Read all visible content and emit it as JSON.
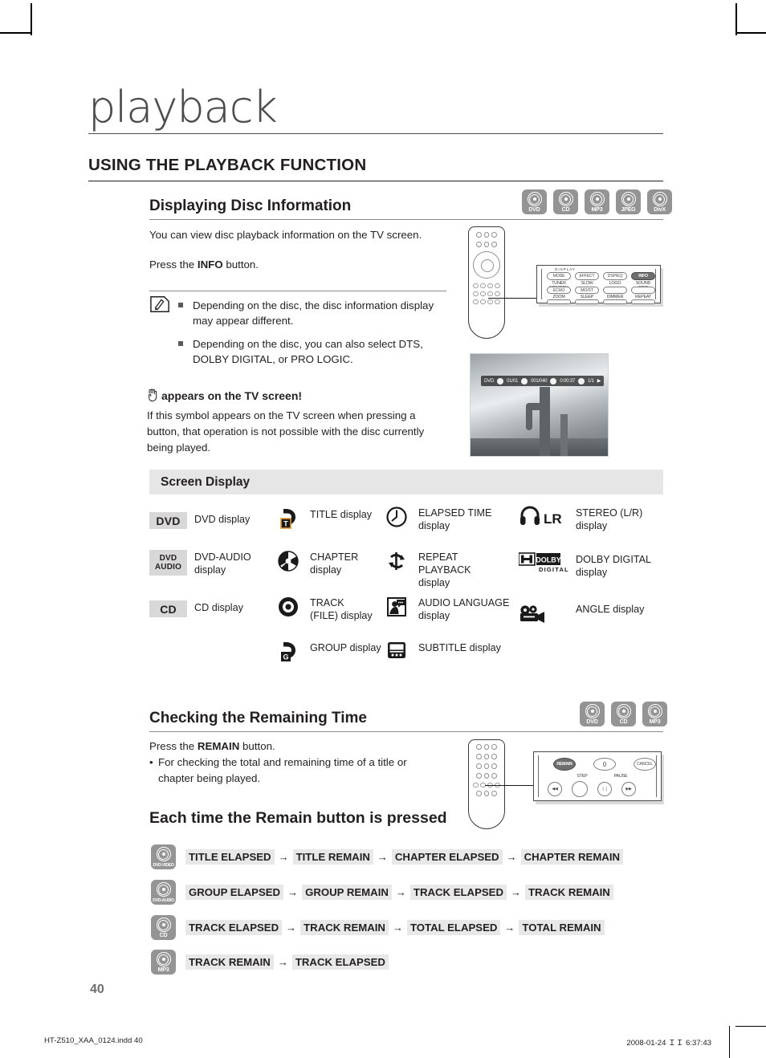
{
  "page": {
    "chapter_title": "playback",
    "section_title": "USING THE PLAYBACK FUNCTION",
    "page_number": "40"
  },
  "footer": {
    "file_name": "HT-Z510_XAA_0124.indd   40",
    "timestamp": "2008-01-24   ＩＩ 6:37:43"
  },
  "disc_info": {
    "heading": "Displaying Disc Information",
    "badges": [
      {
        "label": "DVD",
        "icon": "disc-icon"
      },
      {
        "label": "CD",
        "icon": "disc-icon"
      },
      {
        "label": "MP3",
        "icon": "disc-icon"
      },
      {
        "label": "JPEG",
        "icon": "disc-icon"
      },
      {
        "label": "DivX",
        "icon": "disc-icon"
      }
    ],
    "intro": "You can view disc playback information  on the TV screen.",
    "press_prefix": "Press the ",
    "press_bold": "INFO",
    "press_suffix": " button.",
    "notes": [
      "Depending on the disc, the disc information display may appear different.",
      "Depending on the disc, you can also select DTS, DOLBY DIGITAL, or PRO LOGIC."
    ],
    "hand_heading": "appears on the TV screen!",
    "hand_body": "If this symbol appears on the TV screen when pressing a button, that operation is not possible with the disc currently being played."
  },
  "remote_info_callout": {
    "row1": [
      "MODE",
      "EFFECT",
      "DSP/EQ",
      "INFO"
    ],
    "row1_highlight": "INFO",
    "row2_labels": [
      "TUNER MEMORY",
      "SLOW",
      "LOGO",
      "SOUND EDIT"
    ],
    "row2_buttons": [
      "ECHO",
      "MO/ST",
      "",
      ""
    ],
    "row3_labels": [
      "ZOOM",
      "SLEEP",
      "DIMMER",
      "REPEAT"
    ],
    "group_label": "DISPLAY"
  },
  "tv_osd": {
    "disc_type": "DVD",
    "title": "01/01",
    "chapter": "001/040",
    "elapsed": "0:00:37",
    "angle": "1/1"
  },
  "screen_display": {
    "header": "Screen Display",
    "column1": [
      {
        "tag": "DVD",
        "tag_lines": [
          "DVD"
        ],
        "label": "DVD display",
        "icon": "dvd-tag"
      },
      {
        "tag": "DVD AUDIO",
        "tag_lines": [
          "DVD",
          "AUDIO"
        ],
        "label": "DVD-AUDIO display",
        "icon": "dvd-audio-tag"
      },
      {
        "tag": "CD",
        "tag_lines": [
          "CD"
        ],
        "label": "CD display",
        "icon": "cd-tag"
      }
    ],
    "column2": [
      {
        "label": "TITLE display",
        "icon": "title-icon"
      },
      {
        "label": "CHAPTER display",
        "icon": "chapter-icon"
      },
      {
        "label": "TRACK (FILE) display",
        "icon": "track-icon"
      },
      {
        "label": "GROUP display",
        "icon": "group-icon"
      }
    ],
    "column3": [
      {
        "label": "ELAPSED TIME display",
        "icon": "clock-icon"
      },
      {
        "label": "REPEAT PLAYBACK display",
        "icon": "repeat-icon"
      },
      {
        "label": "AUDIO LANGUAGE display",
        "icon": "audio-language-icon"
      },
      {
        "label": "SUBTITLE display",
        "icon": "subtitle-icon"
      }
    ],
    "column4": [
      {
        "label": "STEREO (L/R) display",
        "icon": "headphone-icon",
        "icon_text": "LR"
      },
      {
        "label": "DOLBY DIGITAL display",
        "icon": "dolby-digital-icon",
        "icon_text": "DOLBY DIGITAL"
      },
      {
        "label": "ANGLE display",
        "icon": "angle-camera-icon"
      }
    ]
  },
  "remaining_time": {
    "heading": "Checking the Remaining Time",
    "badges": [
      {
        "label": "DVD",
        "icon": "disc-icon"
      },
      {
        "label": "CD",
        "icon": "disc-icon"
      },
      {
        "label": "MP3",
        "icon": "disc-icon"
      }
    ],
    "press_prefix": "Press the ",
    "press_bold": "REMAIN",
    "press_suffix": " button.",
    "bullet": "For checking the total and remaining time of a title or chapter being played.",
    "each_time_heading": "Each time the Remain button is pressed",
    "callout": {
      "buttons": [
        "REMAIN",
        "0",
        "CANCEL"
      ],
      "highlight": "REMAIN",
      "labels": [
        "STEP",
        "PAUSE"
      ],
      "transport": [
        "◀◀",
        "",
        "❘❘",
        "▶▶"
      ]
    },
    "sequences": [
      {
        "badge": "DVD-VIDEO",
        "items": [
          "TITLE ELAPSED",
          "TITLE REMAIN",
          "CHAPTER ELAPSED",
          "CHAPTER REMAIN"
        ]
      },
      {
        "badge": "DVD-AUDIO",
        "items": [
          "GROUP ELAPSED",
          "GROUP REMAIN",
          "TRACK ELAPSED",
          "TRACK REMAIN"
        ]
      },
      {
        "badge": "CD",
        "items": [
          "TRACK ELAPSED",
          "TRACK REMAIN",
          "TOTAL ELAPSED",
          "TOTAL REMAIN"
        ]
      },
      {
        "badge": "MP3",
        "items": [
          "TRACK REMAIN",
          "TRACK ELAPSED"
        ]
      }
    ],
    "arrow": "→"
  },
  "colors": {
    "badge_gray": "#949494",
    "tag_gray": "#d8d8d8",
    "header_gray": "#e6e6e6",
    "seq_gray": "#e8e8e8",
    "title_gray": "#4a4a4a"
  }
}
